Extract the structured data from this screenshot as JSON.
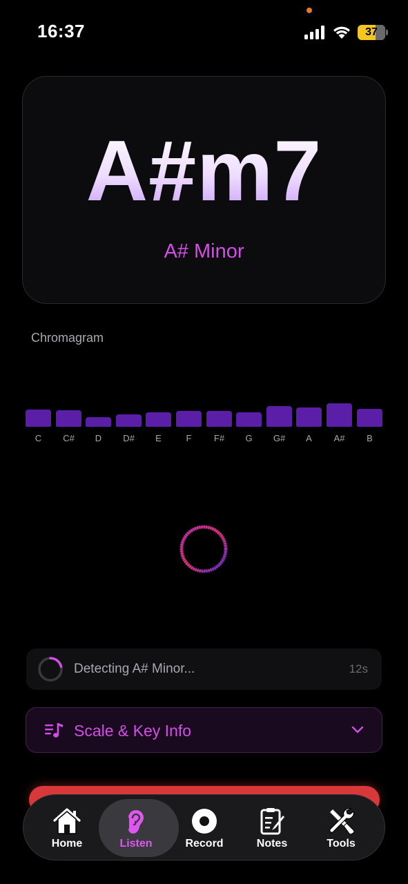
{
  "status_bar": {
    "time": "16:37",
    "battery": "37"
  },
  "chord": {
    "name": "A#m7",
    "key": "A# Minor"
  },
  "chromagram": {
    "label": "Chromagram",
    "notes": [
      {
        "note": "C",
        "level": 0.5
      },
      {
        "note": "C#",
        "level": 0.48
      },
      {
        "note": "D",
        "level": 0.27
      },
      {
        "note": "D#",
        "level": 0.35
      },
      {
        "note": "E",
        "level": 0.42
      },
      {
        "note": "F",
        "level": 0.46
      },
      {
        "note": "F#",
        "level": 0.46
      },
      {
        "note": "G",
        "level": 0.42
      },
      {
        "note": "G#",
        "level": 0.6
      },
      {
        "note": "A",
        "level": 0.56
      },
      {
        "note": "A#",
        "level": 0.68
      },
      {
        "note": "B",
        "level": 0.52
      }
    ],
    "bar_color": "#5a1fa6"
  },
  "detecting": {
    "text": "Detecting A# Minor...",
    "elapsed": "12s"
  },
  "scale_info": {
    "label": "Scale & Key Info",
    "icon": "music-list-icon"
  },
  "tabs": [
    {
      "label": "Home",
      "icon": "home-icon",
      "active": false
    },
    {
      "label": "Listen",
      "icon": "ear-icon",
      "active": true
    },
    {
      "label": "Record",
      "icon": "record-icon",
      "active": false
    },
    {
      "label": "Notes",
      "icon": "clipboard-icon",
      "active": false
    },
    {
      "label": "Tools",
      "icon": "tools-icon",
      "active": false
    }
  ],
  "colors": {
    "accent": "#d44de8",
    "background": "#000000"
  }
}
